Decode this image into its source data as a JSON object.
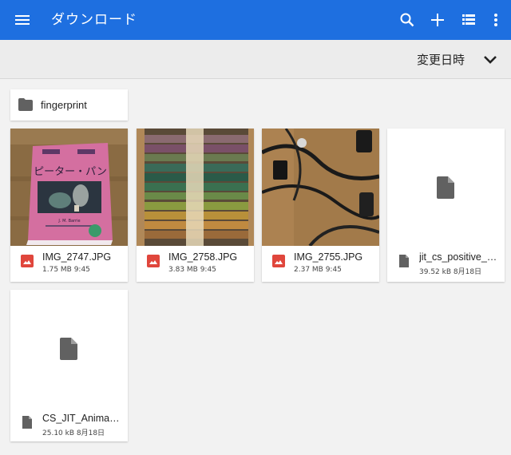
{
  "appbar": {
    "title": "ダウンロード",
    "icons": [
      "menu-icon",
      "search-icon",
      "add-icon",
      "list-view-icon",
      "more-vert-icon"
    ],
    "color": "#1e6fe0"
  },
  "sort": {
    "label": "変更日時",
    "icon": "chevron-down-icon"
  },
  "folders": [
    {
      "name": "fingerprint",
      "icon": "folder-icon"
    }
  ],
  "files": [
    {
      "name": "IMG_2747.JPG",
      "meta": "1.75 MB 9:45",
      "type": "image",
      "icon": "image-icon"
    },
    {
      "name": "IMG_2758.JPG",
      "meta": "3.83 MB 9:45",
      "type": "image",
      "icon": "image-icon"
    },
    {
      "name": "IMG_2755.JPG",
      "meta": "2.37 MB 9:45",
      "type": "image",
      "icon": "image-icon"
    },
    {
      "name": "jit_cs_positive_…",
      "meta": "39.52 kB 8月18日",
      "type": "document",
      "icon": "file-icon"
    },
    {
      "name": "CS_JIT_Animat…",
      "meta": "25.10 kB 8月18日",
      "type": "document",
      "icon": "file-icon"
    }
  ],
  "thumbnails": {
    "book": {
      "title": "ピーター・パン",
      "author": "J. M. Barrie"
    }
  },
  "colors": {
    "image_icon": "#e0463c",
    "doc_icon": "#616161"
  }
}
